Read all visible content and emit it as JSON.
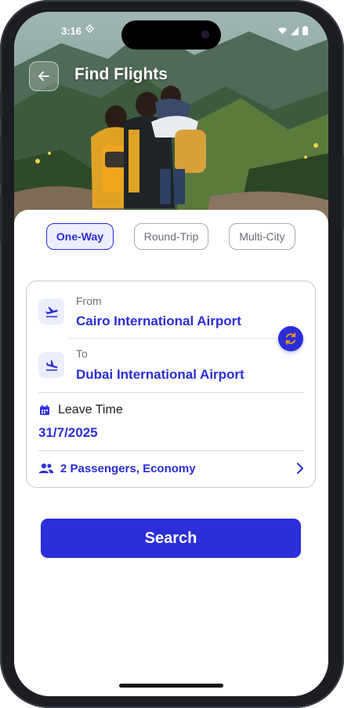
{
  "status_bar": {
    "time": "3:16",
    "extra_icon": "data-saver-icon"
  },
  "header": {
    "title": "Find Flights",
    "back_icon": "arrow-left-icon"
  },
  "trip_types": [
    {
      "label": "One-Way",
      "active": true
    },
    {
      "label": "Round-Trip",
      "active": false
    },
    {
      "label": "Multi-City",
      "active": false
    }
  ],
  "from": {
    "label": "From",
    "value": "Cairo International Airport",
    "icon": "plane-takeoff-icon"
  },
  "to": {
    "label": "To",
    "value": "Dubai International Airport",
    "icon": "plane-landing-icon"
  },
  "swap_icon": "swap-icon",
  "leave": {
    "label": "Leave Time",
    "date": "31/7/2025",
    "icon": "calendar-icon"
  },
  "passengers": {
    "text": "2 Passengers, Economy",
    "icon": "group-icon"
  },
  "search_label": "Search",
  "colors": {
    "primary": "#2B2ED9",
    "chip_bg": "#ECEEFC",
    "border": "#C9CAD2"
  }
}
